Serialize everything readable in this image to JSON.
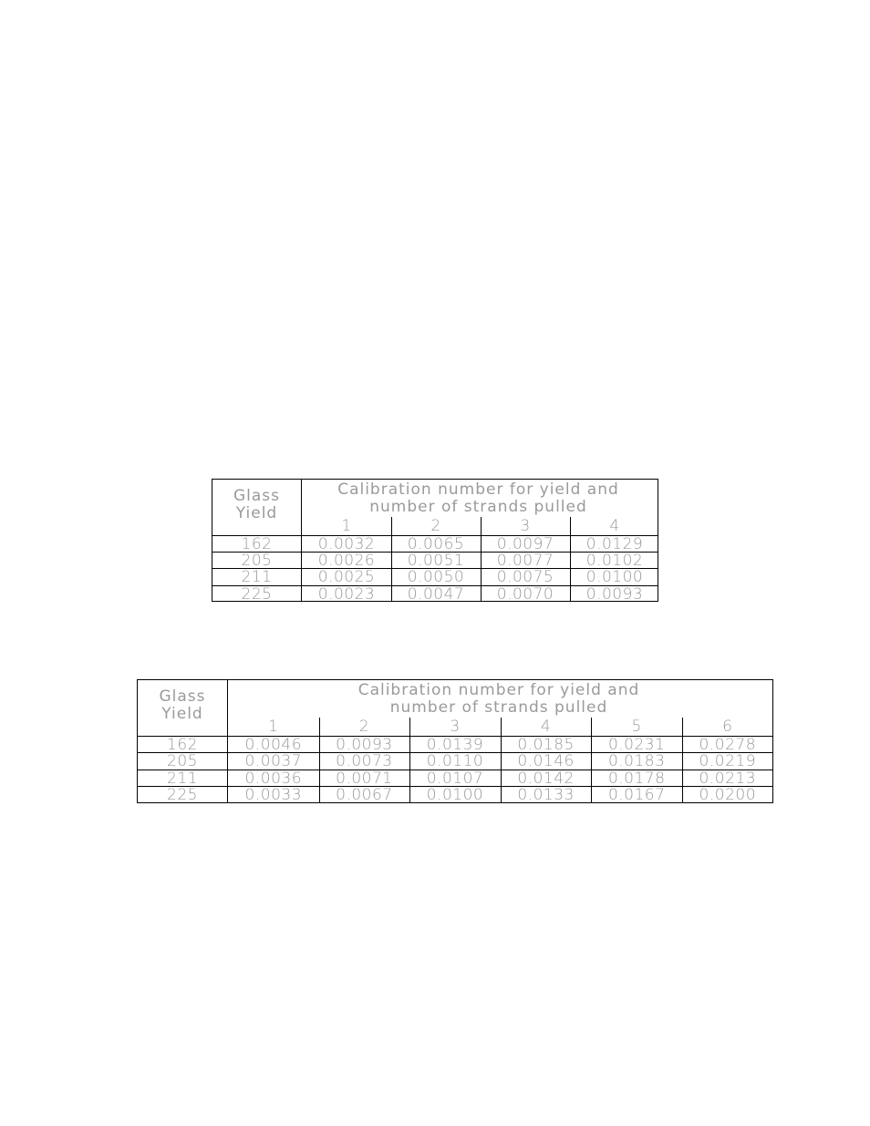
{
  "tables": [
    {
      "row_header": [
        "Glass",
        "Yield"
      ],
      "group_header": [
        "Calibration number for yield and",
        "number of strands pulled"
      ],
      "columns": [
        "1",
        "2",
        "3",
        "4"
      ],
      "rows": [
        {
          "yield": "162",
          "values": [
            "0.0032",
            "0.0065",
            "0.0097",
            "0.0129"
          ]
        },
        {
          "yield": "205",
          "values": [
            "0.0026",
            "0.0051",
            "0.0077",
            "0.0102"
          ]
        },
        {
          "yield": "211",
          "values": [
            "0.0025",
            "0.0050",
            "0.0075",
            "0.0100"
          ]
        },
        {
          "yield": "225",
          "values": [
            "0.0023",
            "0.0047",
            "0.0070",
            "0.0093"
          ]
        }
      ]
    },
    {
      "row_header": [
        "Glass",
        "Yield"
      ],
      "group_header": [
        "Calibration number for yield and",
        "number of strands pulled"
      ],
      "columns": [
        "1",
        "2",
        "3",
        "4",
        "5",
        "6"
      ],
      "rows": [
        {
          "yield": "162",
          "values": [
            "0.0046",
            "0.0093",
            "0.0139",
            "0.0185",
            "0.0231",
            "0.0278"
          ]
        },
        {
          "yield": "205",
          "values": [
            "0.0037",
            "0.0073",
            "0.0110",
            "0.0146",
            "0.0183",
            "0.0219"
          ]
        },
        {
          "yield": "211",
          "values": [
            "0.0036",
            "0.0071",
            "0.0107",
            "0.0142",
            "0.0178",
            "0.0213"
          ]
        },
        {
          "yield": "225",
          "values": [
            "0.0033",
            "0.0067",
            "0.0100",
            "0.0133",
            "0.0167",
            "0.0200"
          ]
        }
      ]
    }
  ]
}
